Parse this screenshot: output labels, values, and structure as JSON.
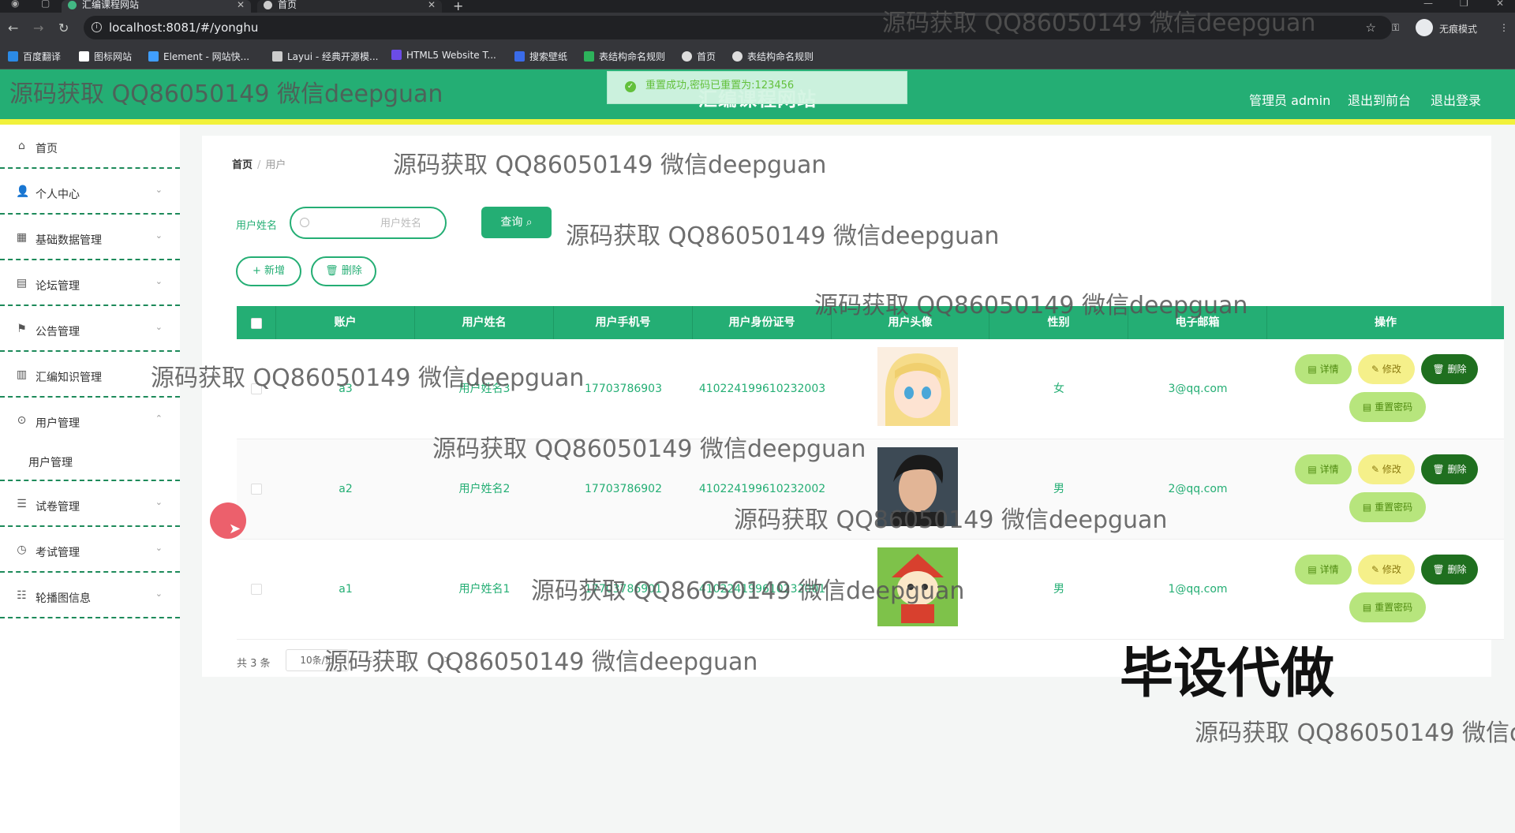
{
  "browser": {
    "tabs": [
      {
        "title": "汇编课程网站",
        "active": true
      },
      {
        "title": "首页",
        "active": false
      }
    ],
    "url": "localhost:8081/#/yonghu",
    "profile_label": "无痕模式",
    "bookmarks": [
      "百度翻译",
      "图标网站",
      "Element - 网站快...",
      "Layui - 经典开源模...",
      "HTML5 Website T...",
      "搜索壁纸",
      "表结构命名规则",
      "首页",
      "表结构命名规则"
    ]
  },
  "header": {
    "site_title": "汇编课程网站",
    "admin_label": "管理员 admin",
    "front_link": "退出到前台",
    "logout_link": "退出登录",
    "toast": "重置成功,密码已重置为:123456"
  },
  "sidebar": {
    "items": [
      {
        "label": "首页",
        "icon": "home-icon"
      },
      {
        "label": "个人中心",
        "icon": "user-icon"
      },
      {
        "label": "基础数据管理",
        "icon": "data-icon"
      },
      {
        "label": "论坛管理",
        "icon": "forum-icon"
      },
      {
        "label": "公告管理",
        "icon": "notice-icon"
      },
      {
        "label": "汇编知识管理",
        "icon": "knowledge-icon"
      },
      {
        "label": "用户管理",
        "icon": "users-icon"
      },
      {
        "label": "试卷管理",
        "icon": "paper-icon"
      },
      {
        "label": "考试管理",
        "icon": "clock-icon"
      },
      {
        "label": "轮播图信息",
        "icon": "carousel-icon"
      }
    ],
    "submenu": "用户管理"
  },
  "breadcrumb": {
    "home": "首页",
    "current": "用户"
  },
  "search": {
    "label": "用户姓名",
    "placeholder": "用户姓名",
    "query_label": "查询"
  },
  "toolbar": {
    "add_label": "+ 新增",
    "delete_label": "删除"
  },
  "table": {
    "columns": [
      "账户",
      "用户姓名",
      "用户手机号",
      "用户身份证号",
      "用户头像",
      "性别",
      "电子邮箱",
      "操作"
    ],
    "rows": [
      {
        "account": "a3",
        "name": "用户姓名3",
        "phone": "17703786903",
        "idcard": "410224199610232003",
        "gender": "女",
        "email": "3@qq.com"
      },
      {
        "account": "a2",
        "name": "用户姓名2",
        "phone": "17703786902",
        "idcard": "410224199610232002",
        "gender": "男",
        "email": "2@qq.com"
      },
      {
        "account": "a1",
        "name": "用户姓名1",
        "phone": "17703786901",
        "idcard": "410224199610232001",
        "gender": "男",
        "email": "1@qq.com"
      }
    ],
    "actions": {
      "detail": "详情",
      "edit": "修改",
      "delete": "删除",
      "reset": "重置密码"
    }
  },
  "pager": {
    "total": "共 3 条",
    "page_size": "10条/页",
    "prev": "<",
    "page": "1",
    "next": ">"
  },
  "watermarks": {
    "text": "源码获取 QQ86050149 微信deepguan",
    "partial": "源码获取 QQ86050149 微信d",
    "big": "毕设代做"
  },
  "colors": {
    "primary": "#24ae74",
    "accent_bar": "#f1f13b",
    "delete": "#1f6f1f"
  }
}
